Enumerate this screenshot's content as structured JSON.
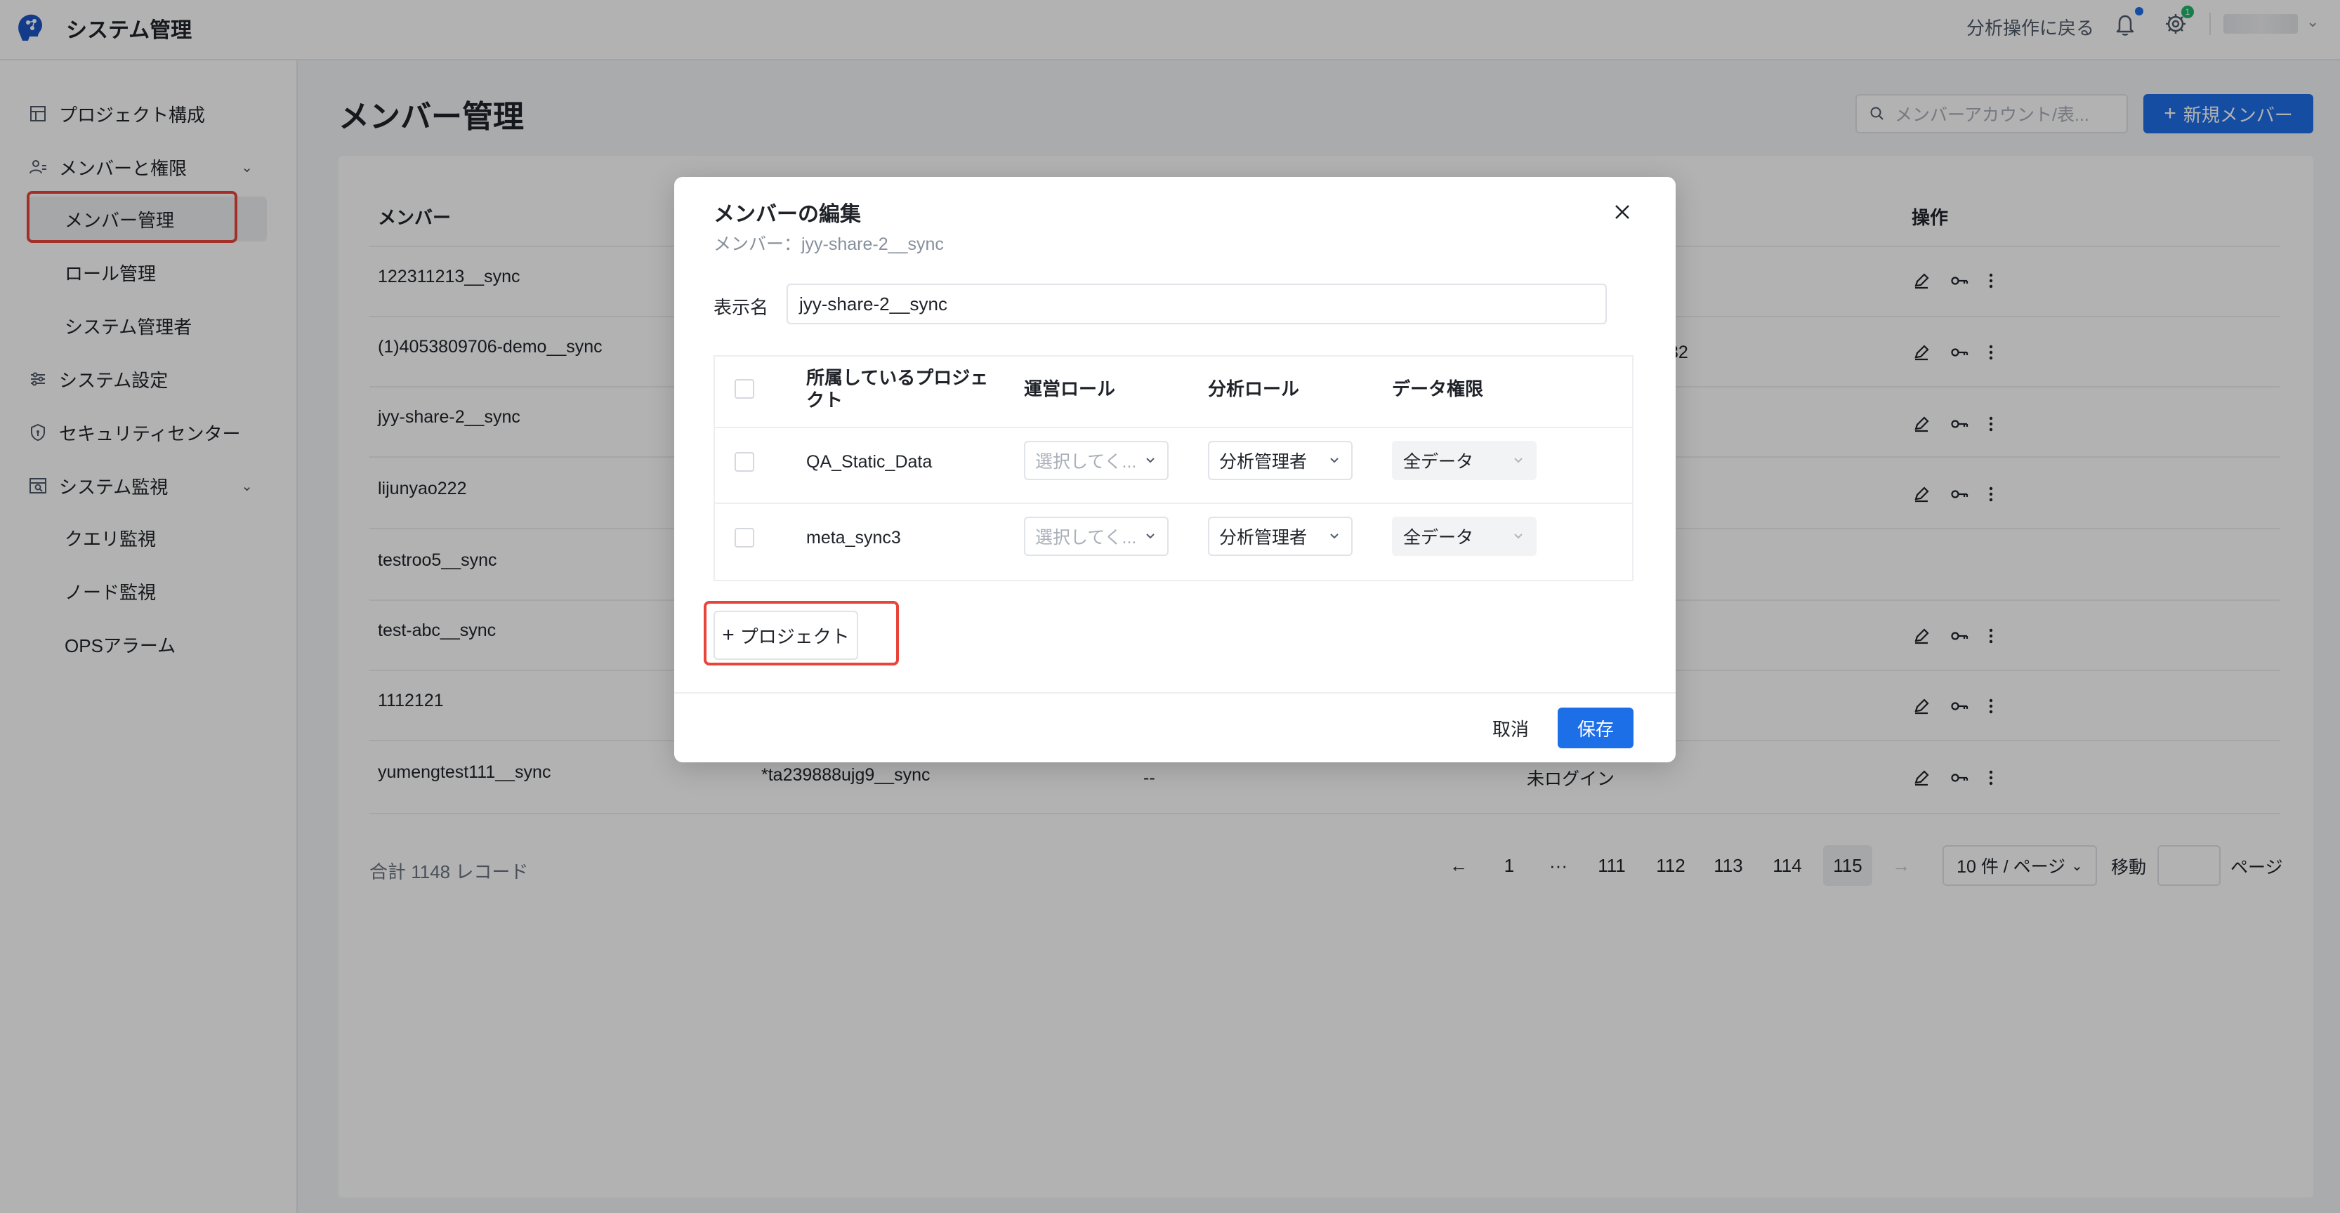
{
  "header": {
    "app_title": "システム管理",
    "back_link": "分析操作に戻る",
    "gear_badge": "1"
  },
  "sidebar": {
    "items": [
      {
        "label": "プロジェクト構成",
        "icon": "layout-icon"
      },
      {
        "label": "メンバーと権限",
        "icon": "users-icon"
      },
      {
        "label": "メンバー管理"
      },
      {
        "label": "ロール管理"
      },
      {
        "label": "システム管理者"
      },
      {
        "label": "システム設定",
        "icon": "sliders-icon"
      },
      {
        "label": "セキュリティセンター",
        "icon": "shield-icon"
      },
      {
        "label": "システム監視",
        "icon": "monitor-icon"
      },
      {
        "label": "クエリ監視"
      },
      {
        "label": "ノード監視"
      },
      {
        "label": "OPSアラーム"
      }
    ]
  },
  "main": {
    "title": "メンバー管理",
    "search_placeholder": "メンバーアカウント/表...",
    "new_member_label": "新規メンバー",
    "columns": {
      "member": "メンバー",
      "ops": "操作"
    },
    "rows": [
      {
        "member": "122311213__sync",
        "col2": "",
        "col3": "",
        "col4": ""
      },
      {
        "member": "(1)4053809706-demo__sync",
        "col2": "",
        "col3": "",
        "col4": "32"
      },
      {
        "member": "jyy-share-2__sync",
        "col2": "",
        "col3": "",
        "col4": ""
      },
      {
        "member": "lijunyao222",
        "col2": "",
        "col3": "",
        "col4": ""
      },
      {
        "member": "testroo5__sync",
        "col2": "",
        "col3": "",
        "col4": ""
      },
      {
        "member": "test-abc__sync",
        "col2": "",
        "col3": "",
        "col4": ""
      },
      {
        "member": "1112121",
        "col2": "",
        "col3": "",
        "col4": ""
      },
      {
        "member": "yumengtest111__sync",
        "col2": "*ta239888ujg9__sync",
        "col3": "--",
        "col4": "未ログイン"
      }
    ],
    "total": "合計 1148 レコード",
    "pagination": {
      "prev": "←",
      "pages": [
        "1",
        "···",
        "111",
        "112",
        "113",
        "114",
        "115"
      ],
      "current": "115",
      "next": "→",
      "page_size": "10 件 / ページ",
      "jump_label": "移動",
      "page_label": "ページ"
    }
  },
  "modal": {
    "title": "メンバーの編集",
    "subtitle": "メンバー：jyy-share-2__sync",
    "display_name_label": "表示名",
    "display_name_value": "jyy-share-2__sync",
    "table_headers": {
      "project": "所属しているプロジェクト",
      "ops_role": "運営ロール",
      "analysis_role": "分析ロール",
      "data_perm": "データ権限"
    },
    "rows": [
      {
        "project": "QA_Static_Data",
        "ops_role": "選択してく...",
        "analysis_role": "分析管理者",
        "data_perm": "全データ"
      },
      {
        "project": "meta_sync3",
        "ops_role": "選択してく...",
        "analysis_role": "分析管理者",
        "data_perm": "全データ"
      }
    ],
    "add_project_label": "プロジェクト",
    "cancel_label": "取消",
    "save_label": "保存"
  },
  "colors": {
    "accent": "#1d6fe8",
    "highlight": "#e8443a",
    "badge": "#21b36b"
  }
}
